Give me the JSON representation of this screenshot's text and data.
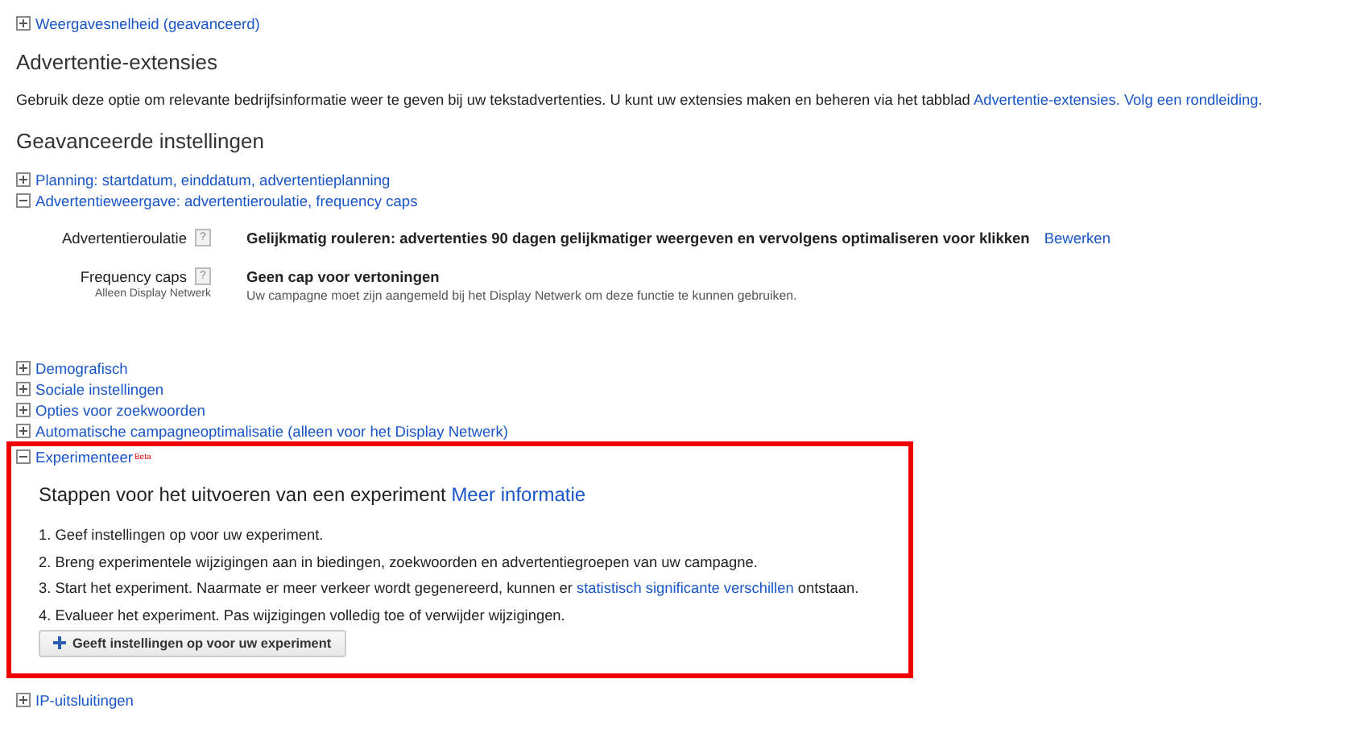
{
  "top_link": {
    "label": "Weergavesnelheid (geavanceerd)",
    "expanded": false
  },
  "extensions": {
    "title": "Advertentie-extensies",
    "text": "Gebruik deze optie om relevante bedrijfsinformatie weer te geven bij uw tekstadvertenties. U kunt uw extensies maken en beheren via het tabblad",
    "links": [
      "Advertentie-extensies.",
      "Volg een rondleiding."
    ]
  },
  "advanced": {
    "title": "Geavanceerde instellingen",
    "items": [
      {
        "label": "Planning: startdatum, einddatum, advertentieplanning",
        "expanded": false,
        "highlighted": false
      },
      {
        "label": "Advertentieweergave: advertentieroulatie, frequency caps",
        "expanded": true,
        "highlighted": false,
        "settings": [
          {
            "label": "Advertentieroulatie",
            "help": "?",
            "value": "Gelijkmatig rouleren: advertenties 90 dagen gelijkmatiger weergeven en vervolgens optimaliseren voor klikken",
            "action": "Bewerken"
          },
          {
            "label": "Frequency caps",
            "help": "?",
            "sublabel": "Alleen Display Netwerk",
            "value": "Geen cap voor vertoningen",
            "note": "Uw campagne moet zijn aangemeld bij het Display Netwerk om deze functie te kunnen gebruiken."
          }
        ]
      },
      {
        "label": "Demografisch",
        "expanded": false,
        "highlighted": false
      },
      {
        "label": "Sociale instellingen",
        "expanded": false,
        "highlighted": false
      },
      {
        "label": "Opties voor zoekwoorden",
        "expanded": false,
        "highlighted": false
      },
      {
        "label": "Automatische campagneoptimalisatie (alleen voor het Display Netwerk)",
        "expanded": false,
        "highlighted": false
      },
      {
        "label": "Experimenteer",
        "badge": "Beta",
        "expanded": true,
        "highlighted": true,
        "experiment": {
          "title": "Stappen voor het uitvoeren van een experiment",
          "link": "Meer informatie",
          "steps": [
            {
              "text": "1. Geef instellingen op voor uw experiment."
            },
            {
              "text": "2. Breng experimentele wijzigingen aan in biedingen, zoekwoorden en advertentiegroepen van uw campagne."
            },
            {
              "text": "3. Start het experiment. Naarmate er meer verkeer wordt gegenereerd, kunnen er",
              "link": "statistisch significante verschillen",
              "after": "ontstaan."
            },
            {
              "text": "4. Evalueer het experiment. Pas wijzigingen volledig toe of verwijder wijzigingen."
            }
          ],
          "button": "Geeft instellingen op voor uw experiment"
        }
      },
      {
        "label": "IP-uitsluitingen",
        "expanded": false,
        "highlighted": false
      }
    ]
  }
}
